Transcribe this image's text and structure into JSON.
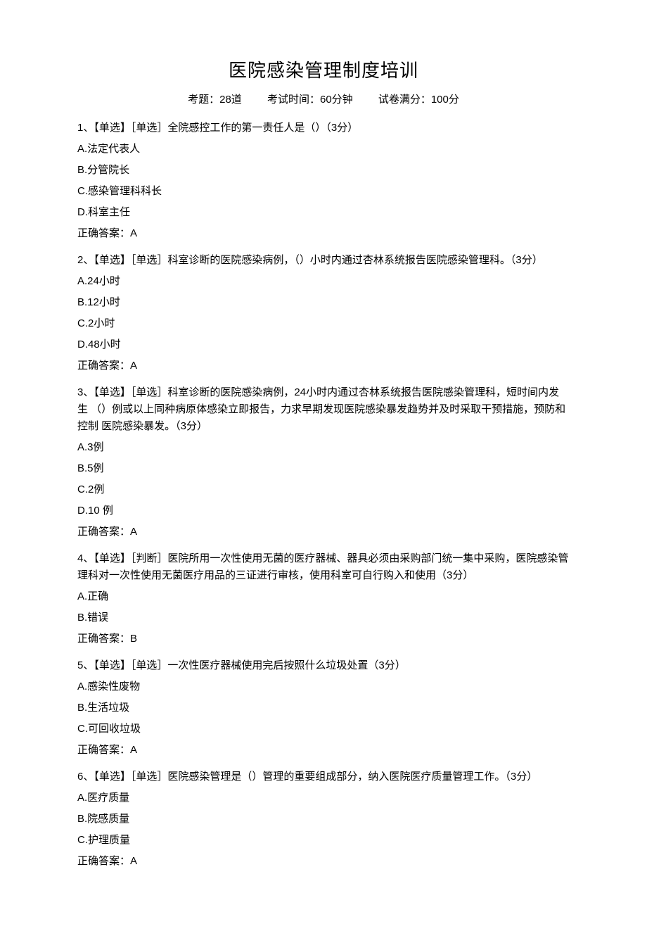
{
  "title": "医院感染管理制度培训",
  "meta": {
    "count": "考题：28道",
    "duration": "考试时间：60分钟",
    "full": "试卷满分：100分"
  },
  "answerLabel": "正确答案：",
  "questions": [
    {
      "stem": "1、【单选】［单选］全院感控工作的第一责任人是（）（3分）",
      "opts": [
        "A.法定代表人",
        "B.分管院长",
        "C.感染管理科科长",
        "D.科室主任"
      ],
      "ans": "A"
    },
    {
      "stem": "2、【单选】［单选］科室诊断的医院感染病例，（）小时内通过杏林系统报告医院感染管理科。（3分）",
      "opts": [
        "A.24小时",
        "B.12小时",
        "C.2小时",
        "D.48小时"
      ],
      "ans": "A"
    },
    {
      "stem": "3、【单选】［单选］科室诊断的医院感染病例，24小时内通过杏林系统报告医院感染管理科，短时间内发生 （）例或以上同种病原体感染立即报告，力求早期发现医院感染暴发趋势并及时采取干预措施，预防和控制 医院感染暴发。（3分）",
      "opts": [
        "A.3例",
        "B.5例",
        "C.2例",
        "D.10 例"
      ],
      "ans": "A"
    },
    {
      "stem": "4、【单选】［判断］医院所用一次性使用无菌的医疗器械、器具必须由采购部门统一集中采购，医院感染管 理科对一次性使用无菌医疗用品的三证进行审核，使用科室可自行购入和使用（3分）",
      "opts": [
        "A.正确",
        "B.错误"
      ],
      "ans": "B"
    },
    {
      "stem": "5、【单选】［单选］一次性医疗器械使用完后按照什么垃圾处置（3分）",
      "opts": [
        "A.感染性废物",
        "B.生活垃圾",
        "C.可回收垃圾"
      ],
      "ans": "A"
    },
    {
      "stem": "6、【单选】［单选］医院感染管理是（）管理的重要组成部分，纳入医院医疗质量管理工作。（3分）",
      "opts": [
        "A.医疗质量",
        "B.院感质量",
        "C.护理质量"
      ],
      "ans": "A"
    }
  ]
}
